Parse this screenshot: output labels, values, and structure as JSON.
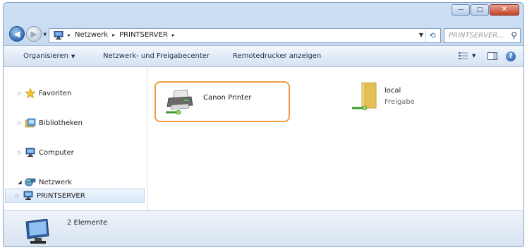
{
  "window": {
    "caption_buttons": [
      {
        "name": "minimize",
        "glyph": "—"
      },
      {
        "name": "maximize",
        "glyph": "□"
      },
      {
        "name": "close",
        "glyph": "✕"
      }
    ]
  },
  "nav": {
    "back_glyph": "◀",
    "forward_glyph": "▶",
    "history_glyph": "▼"
  },
  "address": {
    "crumbs": [
      "Netzwerk",
      "PRINTSERVER"
    ],
    "sep": "▸",
    "dropdown_glyph": "▼",
    "refresh_glyph": "⟲"
  },
  "search": {
    "placeholder": "PRINTSERVER... ",
    "icon_glyph": "⚲"
  },
  "commandbar": {
    "organize_label": "Organisieren",
    "organize_caret": "▼",
    "network_center_label": "Netzwerk- und Freigabecenter",
    "remote_printers_label": "Remotedrucker anzeigen",
    "view_caret": "▼",
    "help_glyph": "?"
  },
  "navpane": {
    "favorites": "Favoriten",
    "libraries": "Bibliotheken",
    "computer": "Computer",
    "network": "Netzwerk",
    "printserver": "PRINTSERVER",
    "tri_closed": "▷",
    "tri_open": "◢"
  },
  "content": {
    "items": [
      {
        "name": "Canon Printer"
      },
      {
        "name": "local",
        "subtitle": "Freigabe"
      }
    ],
    "highlight_color": "#f09a3e"
  },
  "status": {
    "count_text": "2 Elemente"
  }
}
